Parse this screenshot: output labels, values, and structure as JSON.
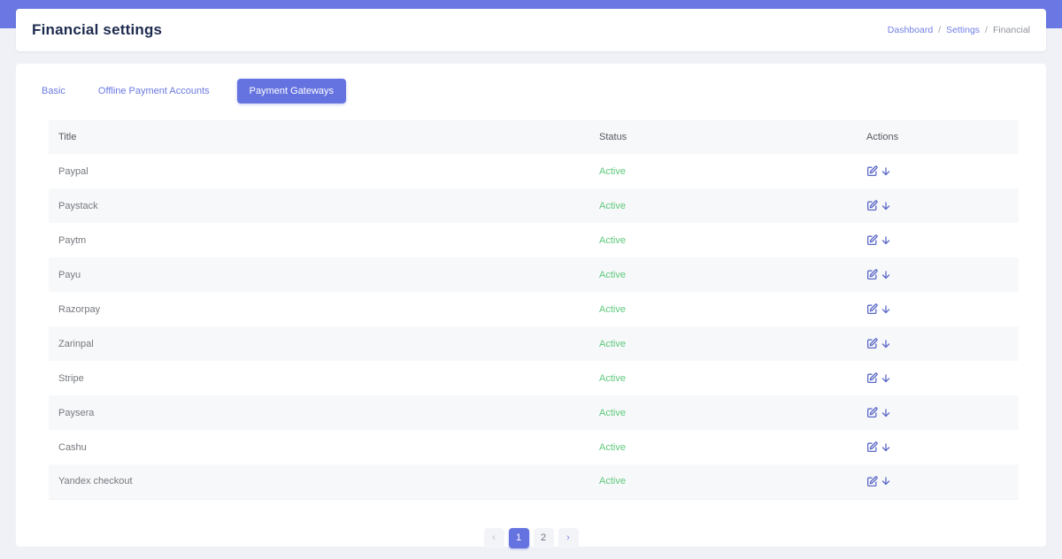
{
  "header": {
    "title": "Financial settings",
    "breadcrumb": {
      "items": [
        {
          "label": "Dashboard"
        },
        {
          "label": "Settings"
        },
        {
          "label": "Financial"
        }
      ],
      "separator": "/"
    }
  },
  "tabs": {
    "items": [
      {
        "label": "Basic",
        "active": false
      },
      {
        "label": "Offline Payment Accounts",
        "active": false
      },
      {
        "label": "Payment Gateways",
        "active": true
      }
    ]
  },
  "table": {
    "columns": {
      "title": "Title",
      "status": "Status",
      "actions": "Actions"
    },
    "rows": [
      {
        "title": "Paypal",
        "status": "Active"
      },
      {
        "title": "Paystack",
        "status": "Active"
      },
      {
        "title": "Paytm",
        "status": "Active"
      },
      {
        "title": "Payu",
        "status": "Active"
      },
      {
        "title": "Razorpay",
        "status": "Active"
      },
      {
        "title": "Zarinpal",
        "status": "Active"
      },
      {
        "title": "Stripe",
        "status": "Active"
      },
      {
        "title": "Paysera",
        "status": "Active"
      },
      {
        "title": "Cashu",
        "status": "Active"
      },
      {
        "title": "Yandex checkout",
        "status": "Active"
      }
    ],
    "row_action_icons": [
      "edit-icon",
      "download-icon"
    ]
  },
  "pagination": {
    "prev": "‹",
    "pages": [
      {
        "label": "1",
        "active": true
      },
      {
        "label": "2",
        "active": false
      }
    ],
    "next": "›"
  },
  "colors": {
    "primary": "#6b78e3",
    "active_button": "#6573e0",
    "link": "#6b7ae0",
    "success": "#5ec97c",
    "page_background": "#f0f1f6",
    "row_stripe": "#f7f8fa",
    "title_text": "#1e2b4f",
    "body_text": "#75787e"
  }
}
